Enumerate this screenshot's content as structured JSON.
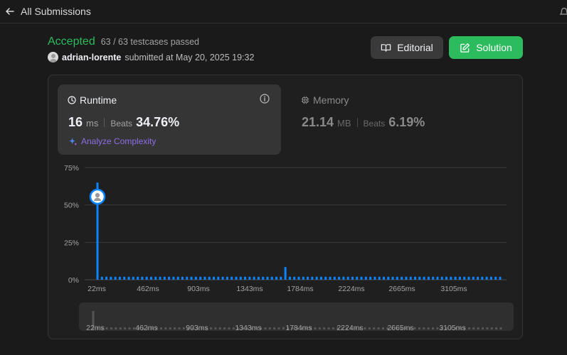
{
  "topbar": {
    "back_label": "All Submissions"
  },
  "submission": {
    "status": "Accepted",
    "testcases": "63 / 63 testcases passed",
    "user": "adrian-lorente",
    "submitted_text": "submitted at May 20, 2025 19:32"
  },
  "buttons": {
    "editorial": "Editorial",
    "solution": "Solution"
  },
  "runtime": {
    "title": "Runtime",
    "value": "16",
    "unit": "ms",
    "beats_label": "Beats",
    "beats_value": "34.76%",
    "analyze": "Analyze Complexity"
  },
  "memory": {
    "title": "Memory",
    "value": "21.14",
    "unit": "MB",
    "beats_label": "Beats",
    "beats_value": "6.19%"
  },
  "colors": {
    "accepted": "#2cbb5d",
    "bar": "#0a84ff",
    "analyze": "#8f6ee6",
    "muted_bar": "#555555"
  },
  "chart_data": {
    "type": "bar",
    "ylim": [
      0,
      75
    ],
    "y_ticks": [
      "0%",
      "25%",
      "50%",
      "75%"
    ],
    "x_ticks": [
      "22ms",
      "462ms",
      "903ms",
      "1343ms",
      "1784ms",
      "2224ms",
      "2665ms",
      "3105ms"
    ],
    "marker_x_ms": 22,
    "series": [
      {
        "values": [
          65,
          2,
          2,
          2,
          2,
          2,
          2,
          2,
          2,
          2,
          2,
          2,
          2,
          2,
          2,
          2,
          2,
          2,
          2,
          2,
          2,
          2,
          2,
          2,
          2,
          2,
          2,
          2,
          2,
          2,
          2,
          2,
          2,
          2,
          2,
          2,
          2,
          2,
          2,
          2,
          2,
          2,
          8.5,
          2,
          2,
          2,
          2,
          2,
          2,
          2,
          2,
          2,
          2,
          2,
          2,
          2,
          2,
          2,
          2,
          2,
          2,
          2,
          2,
          2,
          2,
          2,
          2,
          2,
          2,
          2,
          2,
          2,
          2,
          2,
          2,
          2,
          2,
          2,
          2,
          2,
          2,
          2,
          2,
          2,
          2,
          2,
          2,
          2,
          2,
          2,
          2
        ]
      }
    ]
  }
}
